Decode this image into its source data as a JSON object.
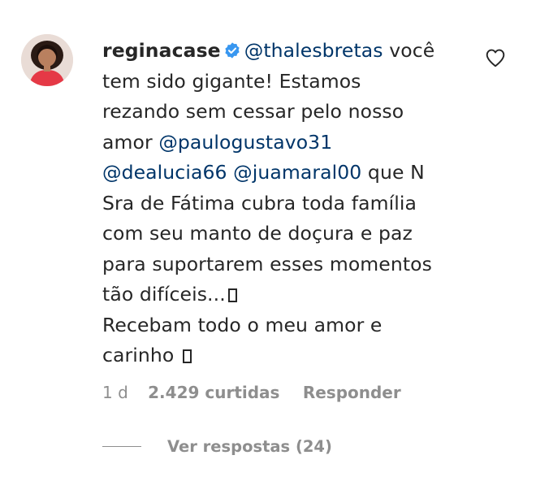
{
  "comment": {
    "username": "reginacase",
    "verified_icon": "verified-badge-icon",
    "lines": [
      {
        "text": "você",
        "mention": "@thalesbretas"
      },
      {
        "text": "tem sido gigante! Estamos"
      },
      {
        "text": "rezando sem cessar pelo nosso"
      },
      {
        "prefix": "amor ",
        "mention": "@paulogustavo31"
      },
      {
        "mention": "@dealucia66",
        "mention2": "@juamaral00",
        "text": " que N"
      },
      {
        "text": "Sra de Fátima cubra toda família"
      },
      {
        "text": "com seu manto de doçura e paz"
      },
      {
        "text": "para suportarem esses momentos"
      },
      {
        "text": "tão difíceis..."
      },
      {
        "text": "Recebam todo o meu amor e"
      },
      {
        "text": "carinho "
      }
    ],
    "like_icon": "heart-outline-icon"
  },
  "meta": {
    "time": "1 d",
    "likes": "2.429 curtidas",
    "reply_label": "Responder"
  },
  "replies": {
    "label": "Ver respostas (24)"
  },
  "colors": {
    "text": "#262626",
    "mention": "#003569",
    "secondary": "#8e8e8e",
    "verified": "#3897f0"
  }
}
